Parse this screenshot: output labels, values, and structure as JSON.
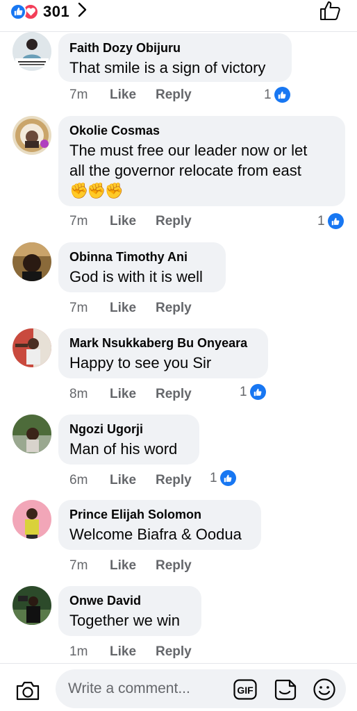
{
  "header": {
    "reaction_count": "301",
    "reactions": [
      "like-icon",
      "love-icon"
    ]
  },
  "comments": [
    {
      "author": "Faith Dozy Obijuru",
      "lines": [
        "That smile is a sign of victory"
      ],
      "time": "7m",
      "like": "Like",
      "reply": "Reply",
      "likes": "1"
    },
    {
      "author": "Okolie Cosmas",
      "lines": [
        "The must free our leader now or let",
        "all the governor relocate from east",
        "✊✊✊"
      ],
      "time": "7m",
      "like": "Like",
      "reply": "Reply",
      "likes": "1"
    },
    {
      "author": "Obinna Timothy Ani",
      "lines": [
        "God is with it is well"
      ],
      "time": "7m",
      "like": "Like",
      "reply": "Reply",
      "likes": ""
    },
    {
      "author": "Mark Nsukkaberg Bu Onyeara",
      "lines": [
        "Happy to see you Sir"
      ],
      "time": "8m",
      "like": "Like",
      "reply": "Reply",
      "likes": "1"
    },
    {
      "author": "Ngozi Ugorji",
      "lines": [
        "Man of his word"
      ],
      "time": "6m",
      "like": "Like",
      "reply": "Reply",
      "likes": "1"
    },
    {
      "author": "Prince Elijah Solomon",
      "lines": [
        "Welcome Biafra & Oodua"
      ],
      "time": "7m",
      "like": "Like",
      "reply": "Reply",
      "likes": ""
    },
    {
      "author": "Onwe David",
      "lines": [
        "Together we win"
      ],
      "time": "1m",
      "like": "Like",
      "reply": "Reply",
      "likes": ""
    }
  ],
  "composer": {
    "placeholder": "Write a comment...",
    "gif_label": "GIF"
  },
  "colors": {
    "accent": "#1877f2",
    "love": "#f33e58",
    "bubble": "#f0f2f5",
    "meta": "#65676b"
  }
}
